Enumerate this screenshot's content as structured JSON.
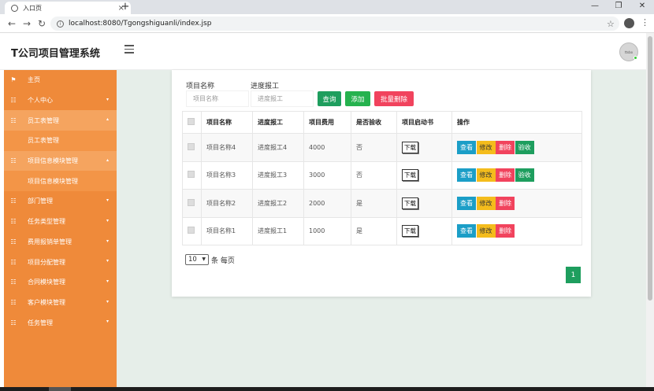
{
  "browser": {
    "tab_title": "入口页",
    "url": "localhost:8080/Tgongshiguanli/index.jsp"
  },
  "header": {
    "brand": "T公司项目管理系统",
    "avatar_text": "ttsbo"
  },
  "sidebar": {
    "items": [
      {
        "label": "主页"
      },
      {
        "label": "个人中心"
      },
      {
        "label": "员工表管理"
      },
      {
        "label": "员工表管理"
      },
      {
        "label": "项目信息模块管理"
      },
      {
        "label": "项目信息模块管理"
      },
      {
        "label": "部门管理"
      },
      {
        "label": "任务类型管理"
      },
      {
        "label": "费用报销单管理"
      },
      {
        "label": "项目分配管理"
      },
      {
        "label": "合同模块管理"
      },
      {
        "label": "客户模块管理"
      },
      {
        "label": "任务管理"
      }
    ]
  },
  "search": {
    "name_label": "项目名称",
    "name_placeholder": "项目名称",
    "progress_label": "进度报工",
    "progress_placeholder": "进度报工",
    "query_btn": "查询",
    "add_btn": "添加",
    "batch_delete_btn": "批量删除"
  },
  "table": {
    "headers": [
      "项目名称",
      "进度报工",
      "项目费用",
      "是否验收",
      "项目启动书",
      "操作"
    ],
    "rows": [
      {
        "name": "项目名称4",
        "progress": "进度报工4",
        "cost": "4000",
        "accepted": "否",
        "download": "下载"
      },
      {
        "name": "项目名称3",
        "progress": "进度报工3",
        "cost": "3000",
        "accepted": "否",
        "download": "下载"
      },
      {
        "name": "项目名称2",
        "progress": "进度报工2",
        "cost": "2000",
        "accepted": "是",
        "download": "下载"
      },
      {
        "name": "项目名称1",
        "progress": "进度报工1",
        "cost": "1000",
        "accepted": "是",
        "download": "下载"
      }
    ],
    "actions": {
      "view": "查看",
      "edit": "修改",
      "delete": "删除",
      "accept": "验收"
    }
  },
  "pager": {
    "page_size": "10",
    "per_page_label": "条 每页",
    "current_page": "1"
  }
}
